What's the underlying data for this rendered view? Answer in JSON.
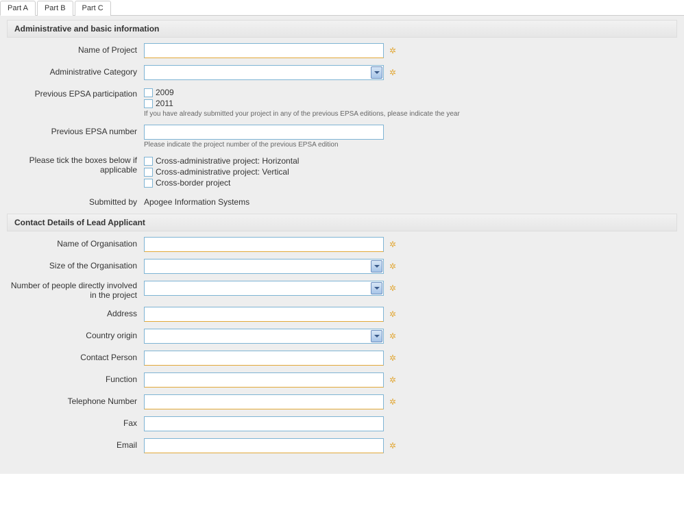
{
  "tabs": [
    "Part A",
    "Part B",
    "Part C"
  ],
  "section1": {
    "title": "Administrative and basic information",
    "name_of_project_label": "Name of Project",
    "admin_category_label": "Administrative Category",
    "prev_epsa_participation_label": "Previous EPSA participation",
    "prev_years": {
      "y2009": "2009",
      "y2011": "2011"
    },
    "prev_years_helper": "If you have already submitted your project in any of the previous EPSA editions, please indicate the year",
    "prev_epsa_number_label": "Previous EPSA number",
    "prev_epsa_number_helper": "Please indicate the project number of the previous EPSA edition",
    "tick_boxes_label": "Please tick the boxes below if applicable",
    "tick_options": {
      "horiz": "Cross-administrative project: Horizontal",
      "vert": "Cross-administrative project: Vertical",
      "border": "Cross-border project"
    },
    "submitted_by_label": "Submitted by",
    "submitted_by_value": "Apogee Information Systems"
  },
  "section2": {
    "title": "Contact Details of Lead Applicant",
    "org_name_label": "Name of Organisation",
    "org_size_label": "Size of the Organisation",
    "people_label": "Number of people directly involved in the project",
    "address_label": "Address",
    "country_label": "Country origin",
    "contact_person_label": "Contact Person",
    "function_label": "Function",
    "telephone_label": "Telephone Number",
    "fax_label": "Fax",
    "email_label": "Email"
  }
}
